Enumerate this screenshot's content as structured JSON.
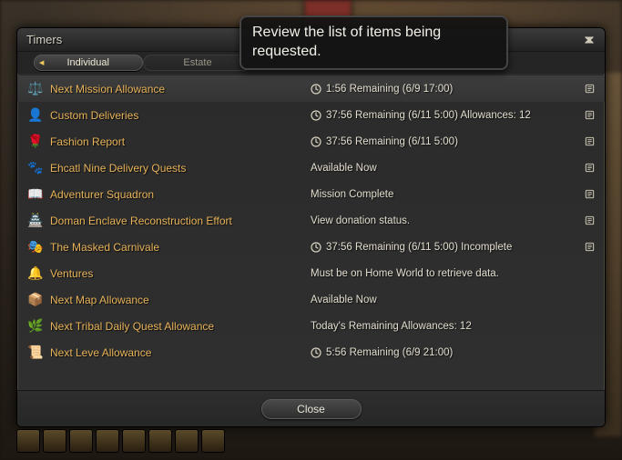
{
  "window": {
    "title": "Timers"
  },
  "tabs": {
    "active": "Individual",
    "inactive": "Estate"
  },
  "tooltip": {
    "text": "Review the list of items being requested."
  },
  "rows": [
    {
      "icon": "⚖️",
      "name": "Next Mission Allowance",
      "clock": true,
      "status": "1:56 Remaining  (6/9 17:00)",
      "book": true,
      "selected": true
    },
    {
      "icon": "👤",
      "name": "Custom Deliveries",
      "clock": true,
      "status": "37:56 Remaining  (6/11 5:00)  Allowances: 12",
      "book": true
    },
    {
      "icon": "🌹",
      "name": "Fashion Report",
      "clock": true,
      "status": "37:56 Remaining  (6/11 5:00)",
      "book": true
    },
    {
      "icon": "🐾",
      "name": "Ehcatl Nine Delivery Quests",
      "clock": false,
      "status": "Available Now",
      "book": true
    },
    {
      "icon": "📖",
      "name": "Adventurer Squadron",
      "clock": false,
      "status": "Mission Complete",
      "book": true
    },
    {
      "icon": "🏯",
      "name": "Doman Enclave Reconstruction Effort",
      "clock": false,
      "status": "View donation status.",
      "book": true
    },
    {
      "icon": "🎭",
      "name": "The Masked Carnivale",
      "clock": true,
      "status": "37:56 Remaining (6/11 5:00) Incomplete",
      "book": true
    },
    {
      "icon": "🔔",
      "name": "Ventures",
      "clock": false,
      "status": "Must be on Home World to retrieve data.",
      "book": false
    },
    {
      "icon": "📦",
      "name": "Next Map Allowance",
      "clock": false,
      "status": "Available Now",
      "book": false
    },
    {
      "icon": "🌿",
      "name": "Next Tribal Daily Quest Allowance",
      "clock": false,
      "status": "Today's Remaining Allowances: 12",
      "book": false
    },
    {
      "icon": "📜",
      "name": "Next Leve Allowance",
      "clock": true,
      "status": "5:56 Remaining  (6/9 21:00)",
      "book": false
    }
  ],
  "footer": {
    "close": "Close"
  }
}
